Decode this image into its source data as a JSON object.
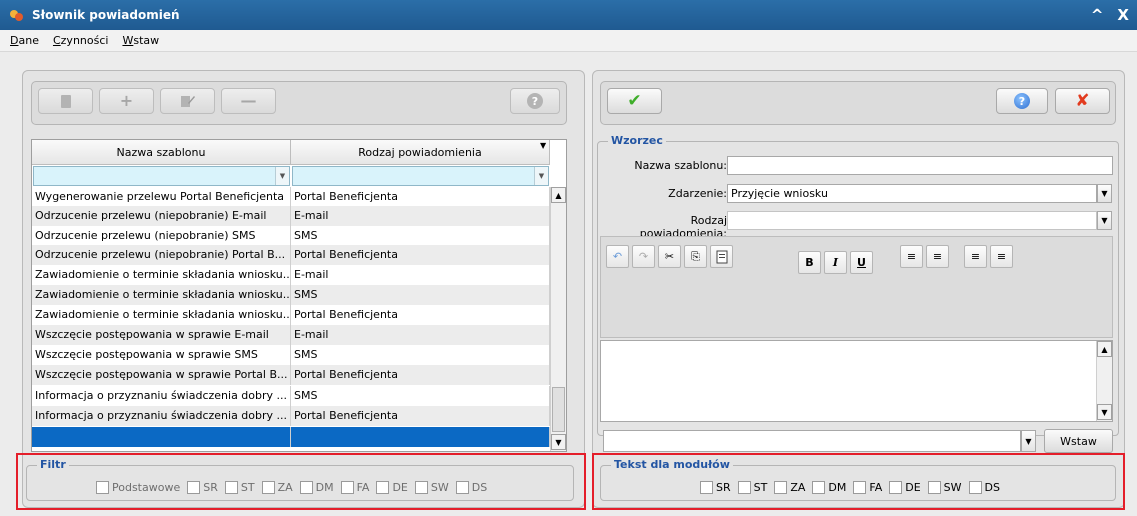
{
  "window": {
    "title": "Słownik powiadomień",
    "minimize": "^",
    "close": "X"
  },
  "menu": [
    "Dane",
    "Czynności",
    "Wstaw"
  ],
  "left_toolbar": {
    "buttons": [
      {
        "name": "open",
        "icon": "document-icon"
      },
      {
        "name": "add",
        "icon": "plus-icon",
        "label": "+"
      },
      {
        "name": "edit",
        "icon": "edit-icon"
      },
      {
        "name": "remove",
        "icon": "minus-icon",
        "label": "—"
      }
    ],
    "help": "?"
  },
  "table": {
    "columns": [
      "Nazwa szablonu",
      "Rodzaj powiadomienia"
    ],
    "sort_indicator": "▼",
    "filter_dropdown": "▼",
    "scroll_up": "▲",
    "scroll_down": "▼",
    "rows": [
      [
        "Wygenerowanie przelewu Portal Beneficjenta",
        "Portal Beneficjenta"
      ],
      [
        "Odrzucenie przelewu (niepobranie) E-mail",
        "E-mail"
      ],
      [
        "Odrzucenie przelewu (niepobranie) SMS",
        "SMS"
      ],
      [
        "Odrzucenie przelewu (niepobranie) Portal B...",
        "Portal Beneficjenta"
      ],
      [
        "Zawiadomienie o terminie składania wniosku...",
        "E-mail"
      ],
      [
        "Zawiadomienie o terminie składania wniosku...",
        "SMS"
      ],
      [
        "Zawiadomienie o terminie składania wniosku...",
        "Portal Beneficjenta"
      ],
      [
        "Wszczęcie postępowania w sprawie E-mail",
        "E-mail"
      ],
      [
        "Wszczęcie postępowania w sprawie SMS",
        "SMS"
      ],
      [
        "Wszczęcie postępowania w sprawie Portal B...",
        "Portal Beneficjenta"
      ],
      [
        "Informacja o przyznaniu świadczenia dobry ...",
        "SMS"
      ],
      [
        "Informacja o przyznaniu świadczenia dobry ...",
        "Portal Beneficjenta"
      ],
      [
        "",
        ""
      ]
    ]
  },
  "filter": {
    "legend": "Filtr",
    "options": [
      "Podstawowe",
      "SR",
      "ST",
      "ZA",
      "DM",
      "FA",
      "DE",
      "SW",
      "DS"
    ]
  },
  "right_toolbar": {
    "confirm": "✔",
    "help": "?",
    "cancel": "✘"
  },
  "form": {
    "legend": "Wzorzec",
    "name_label": "Nazwa szablonu:",
    "name_value": "",
    "event_label": "Zdarzenie:",
    "event_value": "Przyjęcie wniosku",
    "type_label": "Rodzaj powiadomienia:",
    "type_value": "",
    "dropdown_glyph": "▼"
  },
  "editor": {
    "undo": "↶",
    "redo": "↷",
    "cut": "✂",
    "copy": "⎘",
    "paste": "📋",
    "bold": "B",
    "italic": "I",
    "underline": "U",
    "align_left": "≡",
    "align_center": "≡",
    "align_right": "≡",
    "justify": "≡",
    "scroll_up": "▲",
    "scroll_down": "▼"
  },
  "insert": {
    "value": "",
    "button": "Wstaw"
  },
  "modules": {
    "legend": "Tekst dla modułów",
    "options": [
      "SR",
      "ST",
      "ZA",
      "DM",
      "FA",
      "DE",
      "SW",
      "DS"
    ]
  },
  "colors": {
    "title_bar": "#1f5a91",
    "selection": "#0b69c4",
    "highlight_box": "#e41e2a",
    "legend": "#2355a3"
  }
}
